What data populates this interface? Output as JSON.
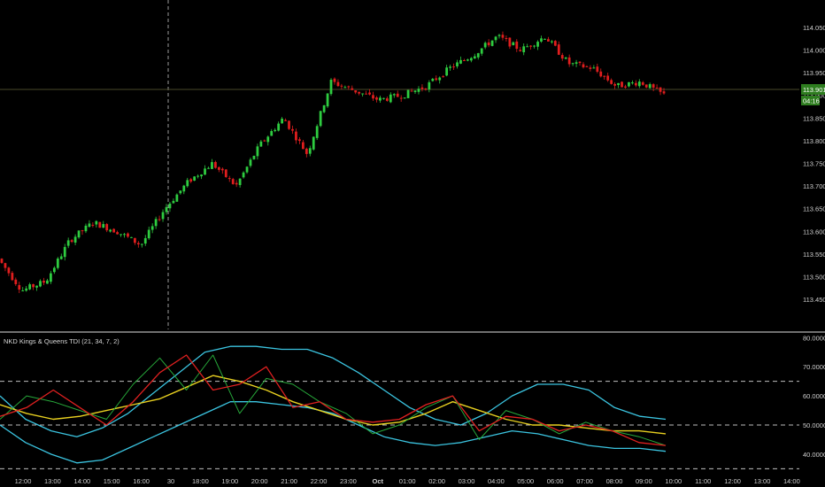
{
  "colors": {
    "background": "#000000",
    "axis_text": "#cfcfcf",
    "up_candle": "#2ecc40",
    "down_candle": "#e01e1e",
    "last_price_badge": "#2e7d1f",
    "current_price_line": "#4a4a2a",
    "crosshair": "#9a9a9a",
    "indicator_band": "#3bc4e0",
    "indicator_base": "#e8d020",
    "indicator_signal": "#e02020",
    "indicator_fast": "#27a83a",
    "dashed_levels": "#bdbdbd",
    "separator": "#e0e0e0"
  },
  "price_panel": {
    "last_price_label": "113.901",
    "countdown_label": "04:16",
    "ticks": [
      "114.050",
      "114.000",
      "113.950",
      "113.900",
      "113.850",
      "113.800",
      "113.750",
      "113.700",
      "113.650",
      "113.600",
      "113.550",
      "113.500",
      "113.450"
    ]
  },
  "indicator_panel": {
    "title": "NKD Kings & Queens TDI (21, 34, 7, 2)",
    "ticks": [
      "80.00000",
      "70.00000",
      "60.00000",
      "50.00000",
      "40.00000"
    ]
  },
  "time_axis": {
    "labels": [
      "12:00",
      "13:00",
      "14:00",
      "15:00",
      "16:00",
      "30",
      "18:00",
      "19:00",
      "20:00",
      "21:00",
      "22:00",
      "23:00",
      "Oct",
      "01:00",
      "02:00",
      "03:00",
      "04:00",
      "05:00",
      "06:00",
      "07:00",
      "08:00",
      "09:00",
      "10:00",
      "11:00",
      "12:00",
      "13:00",
      "14:00"
    ]
  },
  "chart_data": [
    {
      "type": "candlestick",
      "title": "",
      "ylim": [
        113.425,
        114.075
      ],
      "x": [
        "12:00",
        "13:00",
        "14:00",
        "15:00",
        "16:00",
        "30",
        "18:00",
        "19:00",
        "20:00",
        "21:00",
        "22:00",
        "23:00",
        "Oct",
        "01:00",
        "02:00",
        "03:00",
        "04:00",
        "05:00",
        "06:00",
        "07:00",
        "08:00",
        "09:00",
        "10:00"
      ],
      "close_path": [
        113.54,
        113.47,
        113.49,
        113.58,
        113.62,
        113.6,
        113.57,
        113.65,
        113.71,
        113.75,
        113.7,
        113.79,
        113.85,
        113.77,
        113.93,
        113.91,
        113.89,
        113.9,
        113.92,
        113.96,
        113.99,
        114.03,
        114.0,
        114.03,
        113.97,
        113.96,
        113.92,
        113.93,
        113.901
      ],
      "last_price": 113.901
    },
    {
      "type": "line",
      "title": "NKD Kings & Queens TDI (21, 34, 7, 2)",
      "ylim": [
        33,
        81
      ],
      "yticks": [
        80,
        70,
        60,
        50,
        40
      ],
      "dashed_levels": [
        65,
        50,
        35
      ],
      "series": [
        {
          "values": [
            60,
            52,
            48,
            46,
            49,
            54,
            61,
            68,
            75,
            77,
            77,
            76,
            76,
            73,
            68,
            62,
            56,
            52,
            50,
            54,
            60,
            64,
            64,
            62,
            56,
            53,
            52
          ]
        },
        {
          "values": [
            50,
            44,
            40,
            37,
            38,
            42,
            46,
            50,
            54,
            58,
            58,
            57,
            56,
            54,
            50,
            46,
            44,
            43,
            44,
            46,
            48,
            47,
            45,
            43,
            42,
            42,
            41
          ]
        },
        {
          "values": [
            57,
            54,
            52,
            53,
            55,
            57,
            59,
            63,
            67,
            65,
            62,
            58,
            55,
            52,
            50,
            51,
            54,
            58,
            55,
            52,
            50,
            50,
            49,
            48,
            48,
            47
          ]
        },
        {
          "values": [
            52,
            60,
            58,
            55,
            52,
            64,
            73,
            62,
            74,
            54,
            66,
            64,
            58,
            54,
            47,
            50,
            56,
            60,
            45,
            55,
            52,
            47,
            51,
            48,
            46,
            43
          ]
        },
        {
          "values": [
            53,
            56,
            62,
            56,
            50,
            58,
            68,
            74,
            62,
            64,
            70,
            56,
            58,
            52,
            51,
            52,
            57,
            60,
            48,
            53,
            52,
            48,
            50,
            48,
            44,
            43
          ]
        }
      ]
    }
  ]
}
